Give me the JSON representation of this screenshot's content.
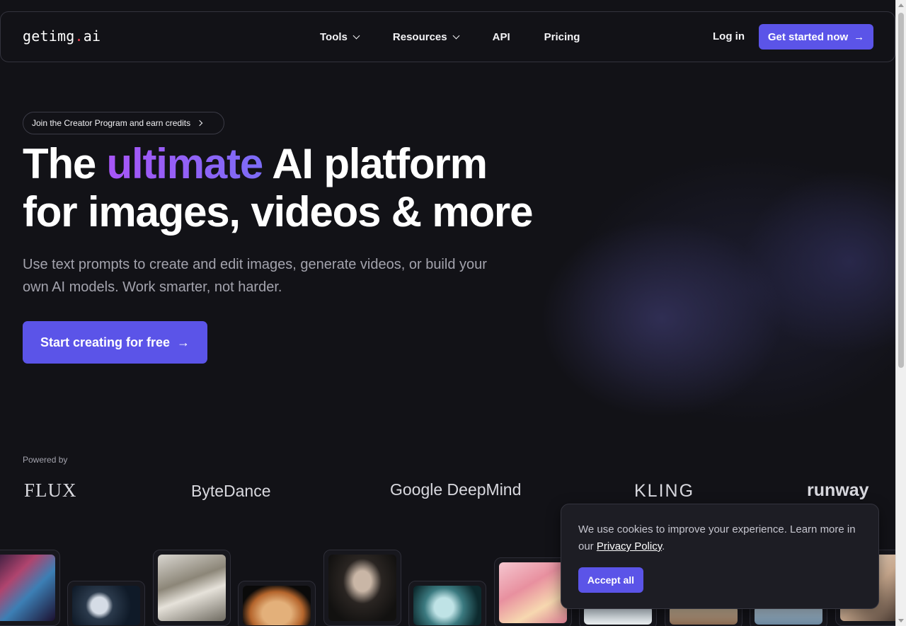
{
  "header": {
    "logo": {
      "prefix": "getimg",
      "dot": ".",
      "suffix": "ai"
    },
    "nav": [
      {
        "label": "Tools",
        "has_dropdown": true
      },
      {
        "label": "Resources",
        "has_dropdown": true
      },
      {
        "label": "API",
        "has_dropdown": false
      },
      {
        "label": "Pricing",
        "has_dropdown": false
      }
    ],
    "login_label": "Log in",
    "cta_label": "Get started now"
  },
  "hero": {
    "pill_label": "Join the Creator Program and earn credits",
    "headline": {
      "part1": "The ",
      "accent": "ultimate",
      "part2": " AI platform",
      "line2": "for images, videos & more"
    },
    "subtext": "Use text prompts to create and edit images, generate videos, or build your own AI models. Work smarter, not harder.",
    "cta_label": "Start creating for free"
  },
  "powered_by": {
    "label": "Powered by",
    "brands": [
      "FLUX",
      "ByteDance",
      "Google DeepMind",
      "KLING",
      "runway"
    ]
  },
  "cookie": {
    "text": "We use cookies to improve your experience. Learn more in our ",
    "link_label": "Privacy Policy",
    "after_link": ".",
    "accept_label": "Accept all"
  },
  "colors": {
    "background": "#121217",
    "primary": "#5b54e8",
    "accent_gradient": [
      "#a855f7",
      "#7c6cf6"
    ],
    "logo_dot": "#ef4452"
  },
  "icons": [
    "chevron-down-icon",
    "arrow-right-icon",
    "chevron-right-icon"
  ]
}
